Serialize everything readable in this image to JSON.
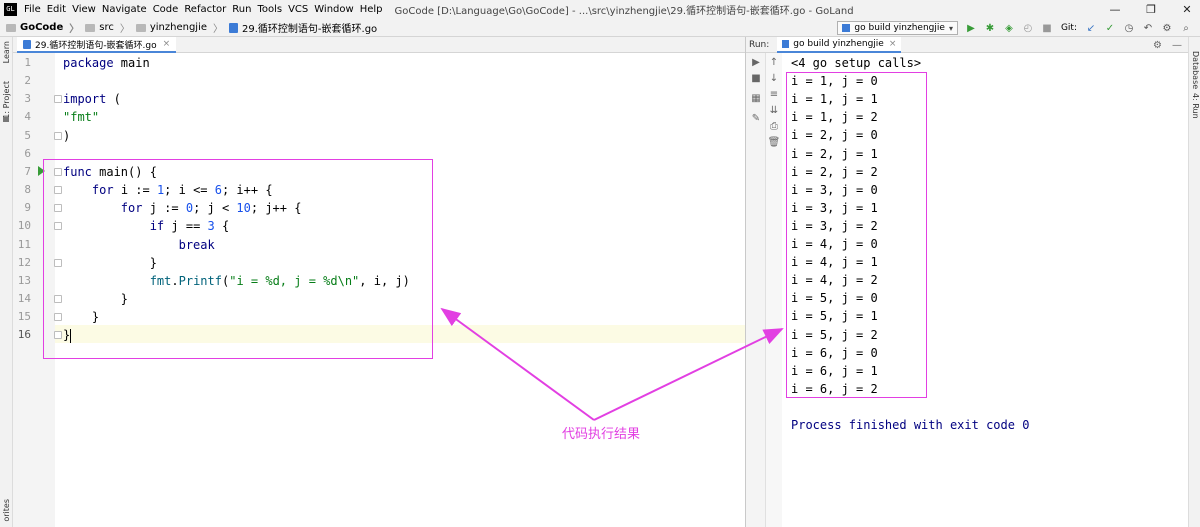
{
  "menubar": {
    "app_icon": "GL",
    "items": [
      "File",
      "Edit",
      "View",
      "Navigate",
      "Code",
      "Refactor",
      "Run",
      "Tools",
      "VCS",
      "Window",
      "Help"
    ],
    "window_title": "GoCode [D:\\Language\\Go\\GoCode] - ...\\src\\yinzhengjie\\29.循环控制语句-嵌套循环.go - GoLand",
    "controls": {
      "minimize": "—",
      "restore": "❐",
      "close": "✕"
    }
  },
  "navbar": {
    "breadcrumbs": [
      "GoCode",
      "src",
      "yinzhengjie",
      "29.循环控制语句-嵌套循环.go"
    ],
    "run_config": "go build yinzhengjie",
    "git_label": "Git:",
    "icons": [
      "run-icon",
      "debug-icon",
      "coverage-icon",
      "profile-icon",
      "stop-icon",
      "git-update-icon",
      "git-commit-icon",
      "history-icon",
      "revert-icon",
      "settings-icon",
      "search-icon"
    ]
  },
  "left_stripe": {
    "project": "1: Project",
    "learn": "Learn",
    "favorites": "orites"
  },
  "right_stripe": {
    "database": "Database",
    "run": "4: Run"
  },
  "editor": {
    "tab_title": "29.循环控制语句-嵌套循环.go",
    "current_line": 16,
    "lines": [
      {
        "no": "1",
        "tokens": [
          {
            "t": "package ",
            "c": "kw"
          },
          {
            "t": "main",
            "c": "pl"
          }
        ]
      },
      {
        "no": "2",
        "tokens": []
      },
      {
        "no": "3",
        "tokens": [
          {
            "t": "import ",
            "c": "kw"
          },
          {
            "t": "(",
            "c": "pl"
          }
        ]
      },
      {
        "no": "4",
        "tokens": [
          {
            "t": "\"fmt\"",
            "c": "str"
          }
        ]
      },
      {
        "no": "5",
        "tokens": [
          {
            "t": ")",
            "c": "pl"
          }
        ]
      },
      {
        "no": "6",
        "tokens": []
      },
      {
        "no": "7",
        "tokens": [
          {
            "t": "func ",
            "c": "kw"
          },
          {
            "t": "main() {",
            "c": "pl"
          }
        ]
      },
      {
        "no": "8",
        "tokens": [
          {
            "t": "    ",
            "c": "pl"
          },
          {
            "t": "for ",
            "c": "kw"
          },
          {
            "t": "i := ",
            "c": "pl"
          },
          {
            "t": "1",
            "c": "num"
          },
          {
            "t": "; i <= ",
            "c": "pl"
          },
          {
            "t": "6",
            "c": "num"
          },
          {
            "t": "; i++ {",
            "c": "pl"
          }
        ]
      },
      {
        "no": "9",
        "tokens": [
          {
            "t": "        ",
            "c": "pl"
          },
          {
            "t": "for ",
            "c": "kw"
          },
          {
            "t": "j := ",
            "c": "pl"
          },
          {
            "t": "0",
            "c": "num"
          },
          {
            "t": "; j < ",
            "c": "pl"
          },
          {
            "t": "10",
            "c": "num"
          },
          {
            "t": "; j++ {",
            "c": "pl"
          }
        ]
      },
      {
        "no": "10",
        "tokens": [
          {
            "t": "            ",
            "c": "pl"
          },
          {
            "t": "if ",
            "c": "kw"
          },
          {
            "t": "j == ",
            "c": "pl"
          },
          {
            "t": "3",
            "c": "num"
          },
          {
            "t": " {",
            "c": "pl"
          }
        ]
      },
      {
        "no": "11",
        "tokens": [
          {
            "t": "                ",
            "c": "pl"
          },
          {
            "t": "break",
            "c": "kw"
          }
        ]
      },
      {
        "no": "12",
        "tokens": [
          {
            "t": "            }",
            "c": "pl"
          }
        ]
      },
      {
        "no": "13",
        "tokens": [
          {
            "t": "            ",
            "c": "pl"
          },
          {
            "t": "fmt",
            "c": "fn"
          },
          {
            "t": ".",
            "c": "pl"
          },
          {
            "t": "Printf",
            "c": "fn"
          },
          {
            "t": "(",
            "c": "pl"
          },
          {
            "t": "\"i = %d, j = %d\\n\"",
            "c": "str"
          },
          {
            "t": ", i, j)",
            "c": "pl"
          }
        ]
      },
      {
        "no": "14",
        "tokens": [
          {
            "t": "        }",
            "c": "pl"
          }
        ]
      },
      {
        "no": "15",
        "tokens": [
          {
            "t": "    }",
            "c": "pl"
          }
        ]
      },
      {
        "no": "16",
        "tokens": [
          {
            "t": "}",
            "c": "pl"
          }
        ]
      }
    ]
  },
  "run_panel": {
    "label": "Run:",
    "tab_title": "go build yinzhengjie",
    "header_icons": [
      "gear-icon",
      "minimize-icon"
    ],
    "output": [
      "<4 go setup calls>",
      "i = 1, j = 0",
      "i = 1, j = 1",
      "i = 1, j = 2",
      "i = 2, j = 0",
      "i = 2, j = 1",
      "i = 2, j = 2",
      "i = 3, j = 0",
      "i = 3, j = 1",
      "i = 3, j = 2",
      "i = 4, j = 0",
      "i = 4, j = 1",
      "i = 4, j = 2",
      "i = 5, j = 0",
      "i = 5, j = 1",
      "i = 5, j = 2",
      "i = 6, j = 0",
      "i = 6, j = 1",
      "i = 6, j = 2",
      "",
      "Process finished with exit code 0"
    ]
  },
  "annotation": {
    "label": "代码执行结果",
    "color": "#e23fe2"
  }
}
